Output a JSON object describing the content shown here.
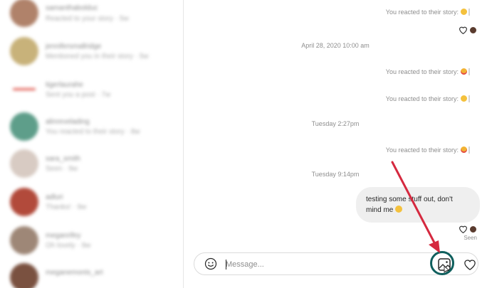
{
  "sidebar": {
    "conversations": [
      {
        "name": "samanthabolduc",
        "preview": "Reacted to your story · 5w",
        "avatar_color": "#b0826a"
      },
      {
        "name": "jennifersmallridge",
        "preview": "Mentioned you in their story · 5w",
        "avatar_color": "#c8b27a"
      },
      {
        "name": "tigerlaurahe",
        "preview": "Sent you a post · 7w",
        "avatar_color": "#e9e0e0"
      },
      {
        "name": "alinrevelading",
        "preview": "You reacted to their story · 8w",
        "avatar_color": "#5e9e8a"
      },
      {
        "name": "sara_smith",
        "preview": "Seen · 9w",
        "avatar_color": "#d8cbc3"
      },
      {
        "name": "adluri",
        "preview": "Thanks! · 9w",
        "avatar_color": "#b24a3b"
      },
      {
        "name": "meganrifey",
        "preview": "Oh lovely · 9w",
        "avatar_color": "#9e8777"
      },
      {
        "name": "meganemonts_art",
        "preview": "",
        "avatar_color": "#7a5140"
      }
    ]
  },
  "chat": {
    "reactions": [
      {
        "text": "You reacted to their story:",
        "emoji": "laugh"
      },
      {
        "text": "You reacted to their story:",
        "emoji": "love"
      },
      {
        "text": "You reacted to their story:",
        "emoji": "laugh"
      },
      {
        "text": "You reacted to their story:",
        "emoji": "love"
      }
    ],
    "timestamps": [
      "April 28, 2020 10:00 am",
      "Tuesday 2:27pm",
      "Tuesday 9:14pm"
    ],
    "outgoing_message": "testing some stuff out, don't mind me",
    "seen_label": "Seen"
  },
  "composer": {
    "placeholder": "Message...",
    "value": ""
  },
  "colors": {
    "highlight_ring": "#0f5f5d",
    "annotation_arrow": "#d5293f"
  },
  "icons": {
    "emoji_button": "smiley-icon",
    "image_button": "image-upload-icon",
    "like_button": "heart-icon"
  }
}
